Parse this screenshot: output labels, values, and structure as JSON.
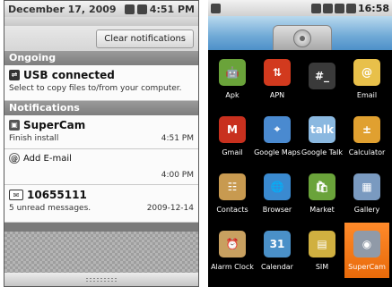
{
  "left": {
    "status": {
      "date": "December 17, 2009",
      "time": "4:51 PM"
    },
    "clear_button": "Clear notifications",
    "sections": {
      "ongoing": "Ongoing",
      "notifications": "Notifications"
    },
    "usb": {
      "title": "USB connected",
      "sub": "Select to copy files to/from your computer."
    },
    "supercam": {
      "title": "SuperCam",
      "sub": "Finish install",
      "time": "4:51 PM"
    },
    "email": {
      "title": "Add E-mail",
      "time": "4:00 PM"
    },
    "message": {
      "title": "10655111",
      "sub": "5 unread messages.",
      "date": "2009-12-14"
    }
  },
  "right": {
    "status": {
      "time": "16:58"
    },
    "apps": [
      {
        "label": "Apk",
        "icon": "android-icon",
        "color": "#6aa33a"
      },
      {
        "label": "APN",
        "icon": "apn-icon",
        "color": "#d23a1e"
      },
      {
        "label": "",
        "icon": "terminal-icon",
        "color": "#3a3a3a"
      },
      {
        "label": "Email",
        "icon": "email-icon",
        "color": "#e8c04a"
      },
      {
        "label": "Gmail",
        "icon": "gmail-icon",
        "color": "#c8301e"
      },
      {
        "label": "Google Maps",
        "icon": "maps-icon",
        "color": "#4a8ad0"
      },
      {
        "label": "Google Talk",
        "icon": "talk-icon",
        "color": "#8ab8e0"
      },
      {
        "label": "Calculator",
        "icon": "calculator-icon",
        "color": "#e0a030"
      },
      {
        "label": "Contacts",
        "icon": "contacts-icon",
        "color": "#c89a50"
      },
      {
        "label": "Browser",
        "icon": "browser-icon",
        "color": "#3a8ad0"
      },
      {
        "label": "Market",
        "icon": "market-icon",
        "color": "#6aa33a"
      },
      {
        "label": "Gallery",
        "icon": "gallery-icon",
        "color": "#7a9ac0"
      },
      {
        "label": "Alarm Clock",
        "icon": "alarm-clock-icon",
        "color": "#c8a060"
      },
      {
        "label": "Calendar",
        "icon": "calendar-icon",
        "color": "#4a90c8"
      },
      {
        "label": "SIM",
        "icon": "sim-icon",
        "color": "#d0b040"
      },
      {
        "label": "SuperCam",
        "icon": "camera-icon",
        "color": "#909aa8"
      }
    ],
    "glyphs": {
      "apk": "🤖",
      "apn": "⇅",
      "terminal": "#_",
      "email": "@",
      "gmail": "M",
      "maps": "⌖",
      "talk": "talk",
      "calculator": "±",
      "contacts": "☷",
      "browser": "🌐",
      "market": "🛍",
      "gallery": "▦",
      "alarm": "⏰",
      "calendar": "31",
      "sim": "▤",
      "camera": "◉"
    },
    "selected_app": "SuperCam"
  }
}
